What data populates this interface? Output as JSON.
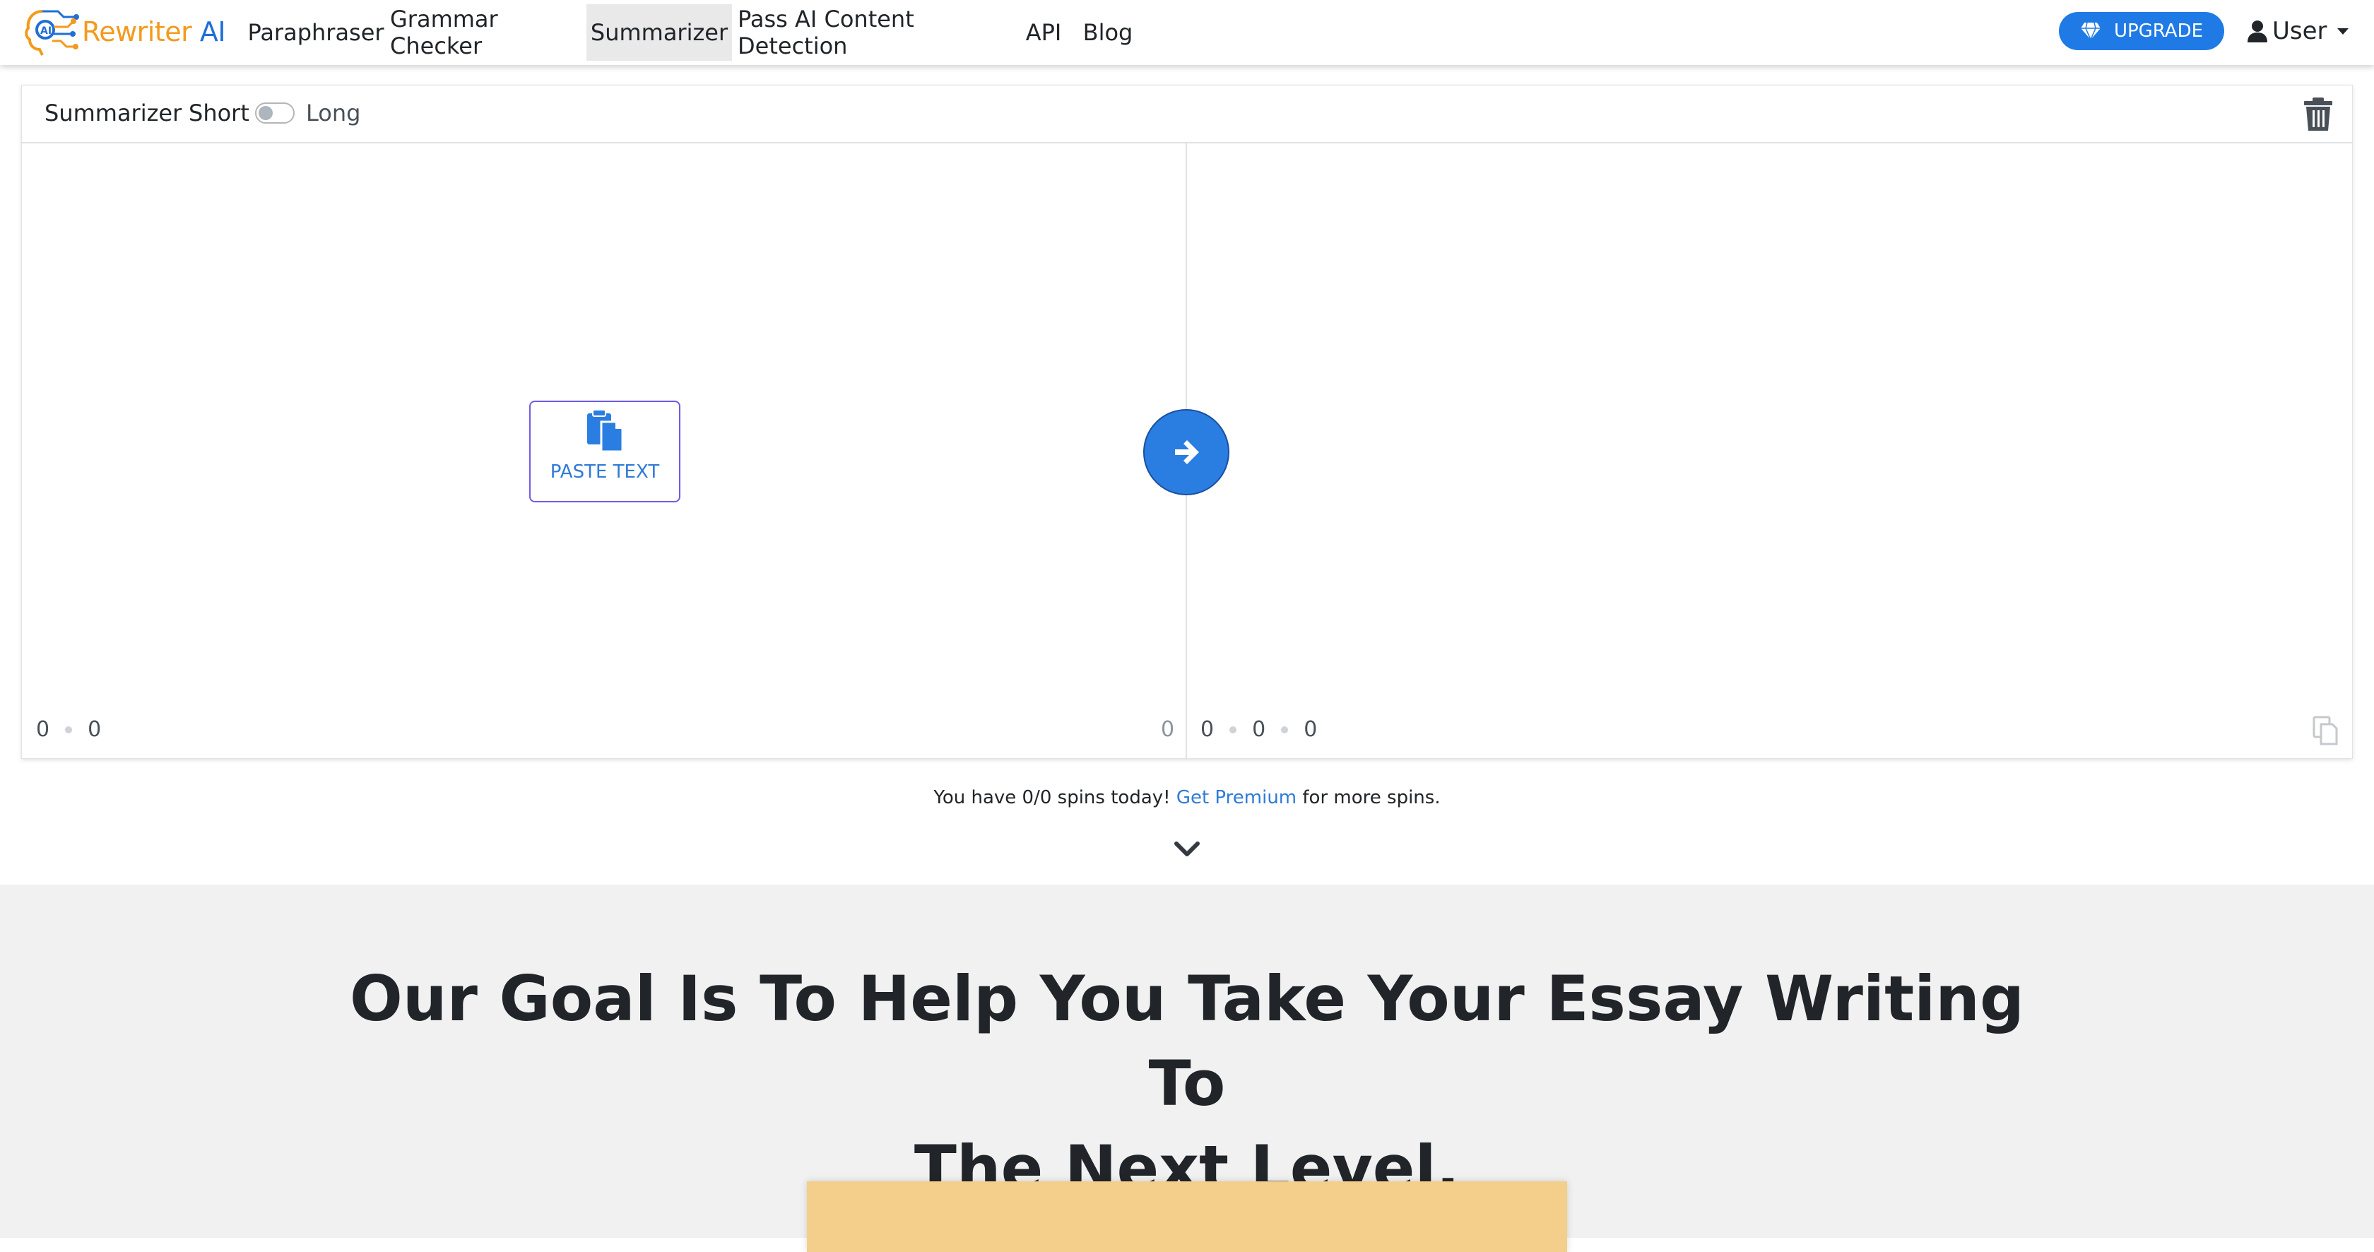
{
  "brand": {
    "name_part1": "Rewriter",
    "name_part2": " AI",
    "orange": "#f39a1e",
    "blue": "#1f6fd6"
  },
  "nav": {
    "items": [
      {
        "label": "Paraphraser",
        "active": false
      },
      {
        "label": "Grammar Checker",
        "active": false
      },
      {
        "label": "Summarizer",
        "active": true
      },
      {
        "label": "Pass AI Content Detection",
        "active": false
      },
      {
        "label": "API",
        "active": false
      },
      {
        "label": "Blog",
        "active": false
      }
    ],
    "upgrade_label": "UPGRADE",
    "user_label": "User"
  },
  "tool": {
    "title": "Summarizer",
    "length_option_short": "Short",
    "length_option_long": "Long",
    "length_mode": "Short",
    "paste_label": "PASTE TEXT",
    "input_stats": [
      "0",
      "0"
    ],
    "input_char_count": "0",
    "output_stats": [
      "0",
      "0",
      "0"
    ]
  },
  "spins": {
    "prefix": "You have 0/0 spins today! ",
    "link": "Get Premium",
    "suffix": " for more spins."
  },
  "section": {
    "headline_line1": "Our Goal Is To Help You Take Your Essay Writing To",
    "headline_line2": "The Next Level."
  },
  "colors": {
    "accent": "#1f7ae6",
    "paste_border": "#6f5be6",
    "feature_card": "#f3cf8b",
    "section_bg": "#f1f1f1"
  },
  "icons": [
    "logo-brain-icon",
    "diamond-icon",
    "user-icon",
    "trash-icon",
    "clipboard-icon",
    "arrow-right-icon",
    "copy-icon",
    "chevron-down-icon"
  ]
}
